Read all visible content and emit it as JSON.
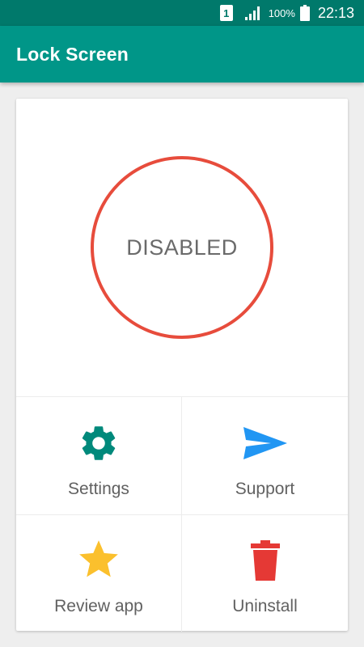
{
  "status_bar": {
    "sim_label": "1",
    "battery_percent": "100%",
    "time": "22:13"
  },
  "app_bar": {
    "title": "Lock Screen"
  },
  "lock_status": {
    "label": "DISABLED",
    "ring_color": "#e74c3c"
  },
  "actions": [
    {
      "label": "Settings",
      "icon": "gear-icon",
      "color": "#00897b"
    },
    {
      "label": "Support",
      "icon": "send-icon",
      "color": "#2196f3"
    },
    {
      "label": "Review app",
      "icon": "star-icon",
      "color": "#fbc02d"
    },
    {
      "label": "Uninstall",
      "icon": "trash-icon",
      "color": "#e53935"
    }
  ],
  "colors": {
    "status_bar": "#00796b",
    "app_bar": "#009688"
  }
}
